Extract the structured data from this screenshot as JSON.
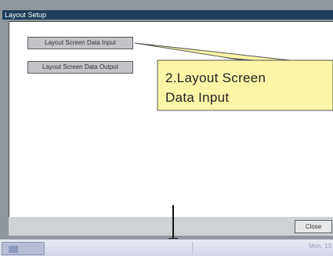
{
  "window": {
    "title": "Layout Setup"
  },
  "buttons": {
    "input_label": "Layout Screen Data Input",
    "output_label": "Layout Screen Data Output",
    "close_label": "Close"
  },
  "callout": {
    "line1": "2.Layout Screen",
    "line2": "Data Input",
    "fill_color": "#fbf6a6"
  },
  "taskbar": {
    "clock_text": "Mon. 13"
  }
}
